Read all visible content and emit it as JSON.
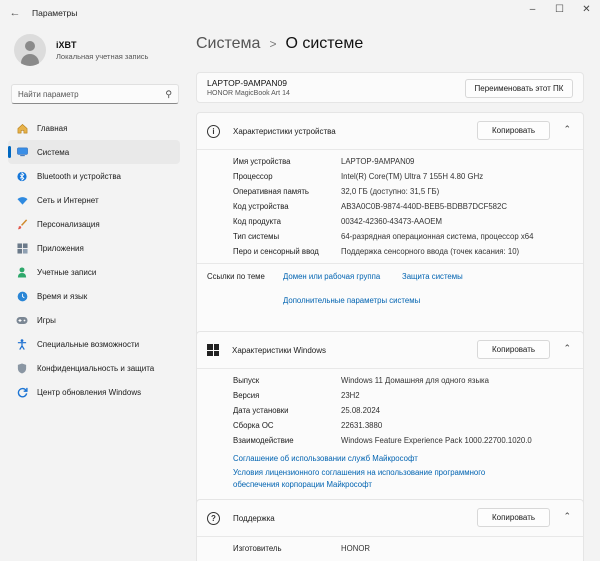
{
  "window": {
    "title": "Параметры",
    "back_icon": "back-arrow-icon",
    "controls": [
      "minimize-icon",
      "maximize-icon",
      "close-icon"
    ]
  },
  "user": {
    "name": "iXBT",
    "account_type": "Локальная учетная запись"
  },
  "search": {
    "placeholder": "Найти параметр"
  },
  "sidebar": {
    "items": [
      {
        "label": "Главная",
        "icon": "home-icon",
        "active": false
      },
      {
        "label": "Система",
        "icon": "system-display-icon",
        "active": true
      },
      {
        "label": "Bluetooth и устройства",
        "icon": "bluetooth-icon",
        "active": false
      },
      {
        "label": "Сеть и Интернет",
        "icon": "wifi-icon",
        "active": false
      },
      {
        "label": "Персонализация",
        "icon": "brush-icon",
        "active": false
      },
      {
        "label": "Приложения",
        "icon": "apps-icon",
        "active": false
      },
      {
        "label": "Учетные записи",
        "icon": "account-icon",
        "active": false
      },
      {
        "label": "Время и язык",
        "icon": "globe-clock-icon",
        "active": false
      },
      {
        "label": "Игры",
        "icon": "gamepad-icon",
        "active": false
      },
      {
        "label": "Специальные возможности",
        "icon": "accessibility-icon",
        "active": false
      },
      {
        "label": "Конфиденциальность и защита",
        "icon": "shield-icon",
        "active": false
      },
      {
        "label": "Центр обновления Windows",
        "icon": "update-icon",
        "active": false
      }
    ]
  },
  "breadcrumb": {
    "parent": "Система",
    "separator": ">",
    "current": "О системе"
  },
  "device_header": {
    "name": "LAPTOP-9AMPAN09",
    "model": "HONOR MagicBook Art 14",
    "rename_label": "Переименовать этот ПК"
  },
  "device_specs": {
    "title": "Характеристики устройства",
    "copy_label": "Копировать",
    "rows": [
      {
        "key": "Имя устройства",
        "value": "LAPTOP-9AMPAN09"
      },
      {
        "key": "Процессор",
        "value": "Intel(R) Core(TM) Ultra 7 155H   4.80 GHz"
      },
      {
        "key": "Оперативная память",
        "value": "32,0 ГБ (доступно: 31,5 ГБ)"
      },
      {
        "key": "Код устройства",
        "value": "AB3A0C0B-9874-440D-BEB5-BDBB7DCF582C"
      },
      {
        "key": "Код продукта",
        "value": "00342-42360-43473-AAOEM"
      },
      {
        "key": "Тип системы",
        "value": "64-разрядная операционная система, процессор x64"
      },
      {
        "key": "Перо и сенсорный ввод",
        "value": "Поддержка сенсорного ввода (точек касания: 10)"
      }
    ],
    "related_label": "Ссылки по теме",
    "related_links": [
      "Домен или рабочая группа",
      "Защита системы",
      "Дополнительные параметры системы"
    ]
  },
  "windows_specs": {
    "title": "Характеристики Windows",
    "copy_label": "Копировать",
    "rows": [
      {
        "key": "Выпуск",
        "value": "Windows 11 Домашняя для одного языка"
      },
      {
        "key": "Версия",
        "value": "23H2"
      },
      {
        "key": "Дата установки",
        "value": "25.08.2024"
      },
      {
        "key": "Сборка ОС",
        "value": "22631.3880"
      },
      {
        "key": "Взаимодействие",
        "value": "Windows Feature Experience Pack 1000.22700.1020.0"
      }
    ],
    "links": [
      "Соглашение об использовании служб Майкрософт",
      "Условия лицензионного соглашения на использование программного",
      "обеспечения корпорации Майкрософт"
    ]
  },
  "support": {
    "title": "Поддержка",
    "copy_label": "Копировать",
    "rows": [
      {
        "key": "Изготовитель",
        "value": "HONOR"
      }
    ]
  }
}
